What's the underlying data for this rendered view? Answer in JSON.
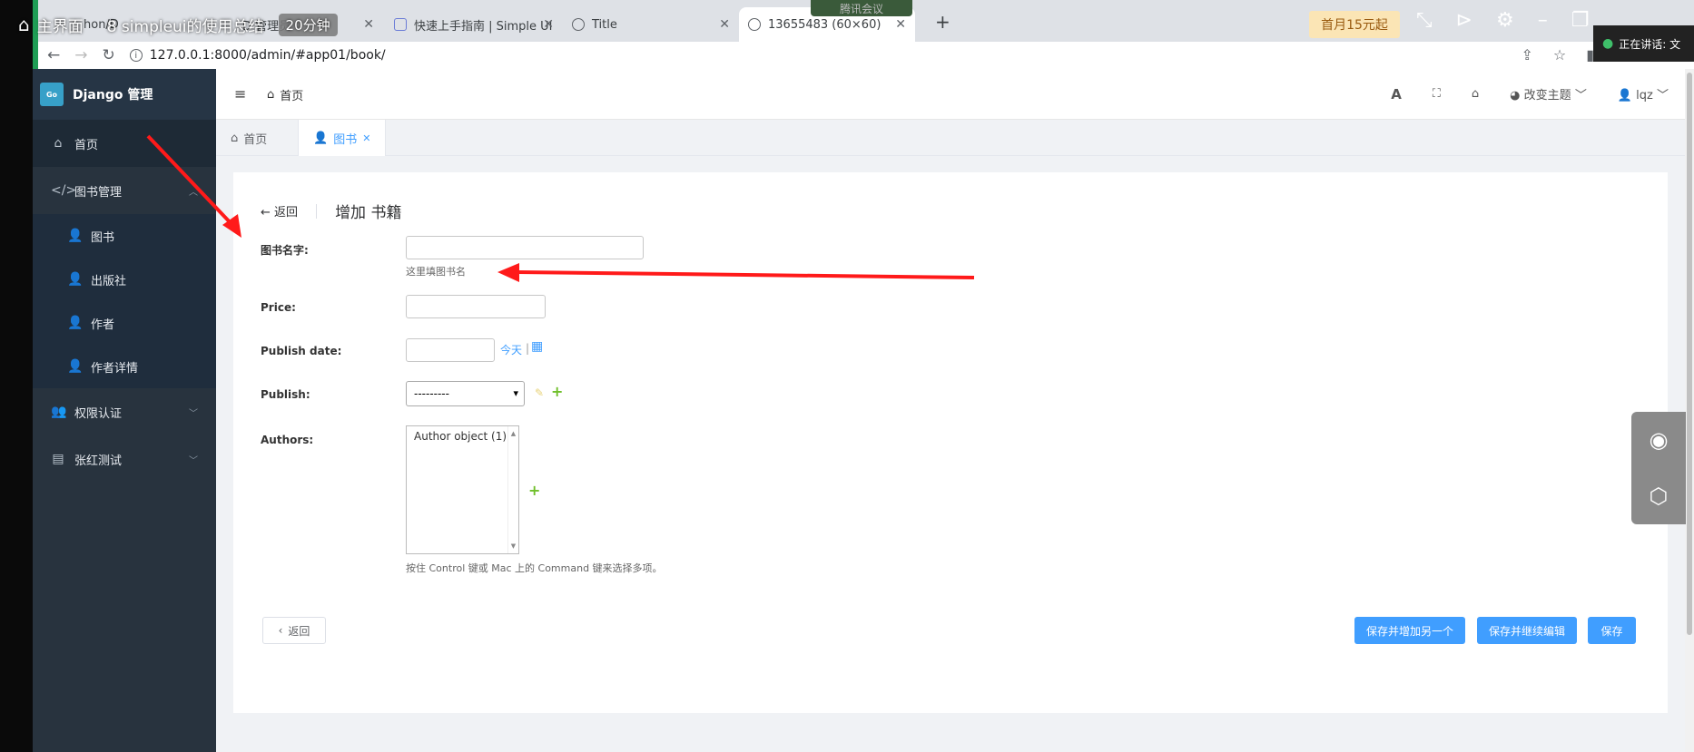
{
  "recorder": {
    "title": "主界面",
    "subtitle": "8 simpleui的使用总结",
    "duration": "20分钟",
    "meeting": "腾讯会议",
    "promo": "首月15元起",
    "speaking": "正在讲话: 文"
  },
  "browser": {
    "tabs": [
      {
        "label": "hon/D"
      },
      {
        "label": "D 管理员"
      },
      {
        "label": "快速上手指南 | Simple UI"
      },
      {
        "label": "Title"
      },
      {
        "label": "13655483 (60×60)"
      }
    ],
    "url": "127.0.0.1:8000/admin/#app01/book/"
  },
  "sidebar": {
    "brand": "Django 管理",
    "logo_text": "Go",
    "items": [
      {
        "label": "首页"
      },
      {
        "label": "图书管理"
      }
    ],
    "sub_items": [
      {
        "label": "图书"
      },
      {
        "label": "出版社"
      },
      {
        "label": "作者"
      },
      {
        "label": "作者详情"
      }
    ],
    "groups": [
      {
        "label": "权限认证"
      },
      {
        "label": "张红测试"
      }
    ]
  },
  "header": {
    "breadcrumb": "首页",
    "theme_label": "改变主题",
    "user": "lqz"
  },
  "page_tabs": [
    {
      "label": "首页"
    },
    {
      "label": "图书"
    }
  ],
  "form": {
    "back_label": "返回",
    "title": "增加 书籍",
    "fields": {
      "name_label": "图书名字:",
      "name_help": "这里填图书名",
      "price_label": "Price:",
      "date_label": "Publish date:",
      "today_link": "今天",
      "date_sep": "|",
      "publish_label": "Publish:",
      "publish_value": "---------",
      "authors_label": "Authors:",
      "authors_option": "Author object (1)",
      "authors_help": "按住 Control 键或 Mac 上的 Command 键来选择多项。"
    },
    "buttons": {
      "back": "返回",
      "save_add": "保存并增加另一个",
      "save_continue": "保存并继续编辑",
      "save": "保存"
    }
  },
  "colors": {
    "sidebar_bg": "#28333e",
    "primary": "#409eff",
    "annotation_arrow": "#ff1a1a"
  }
}
